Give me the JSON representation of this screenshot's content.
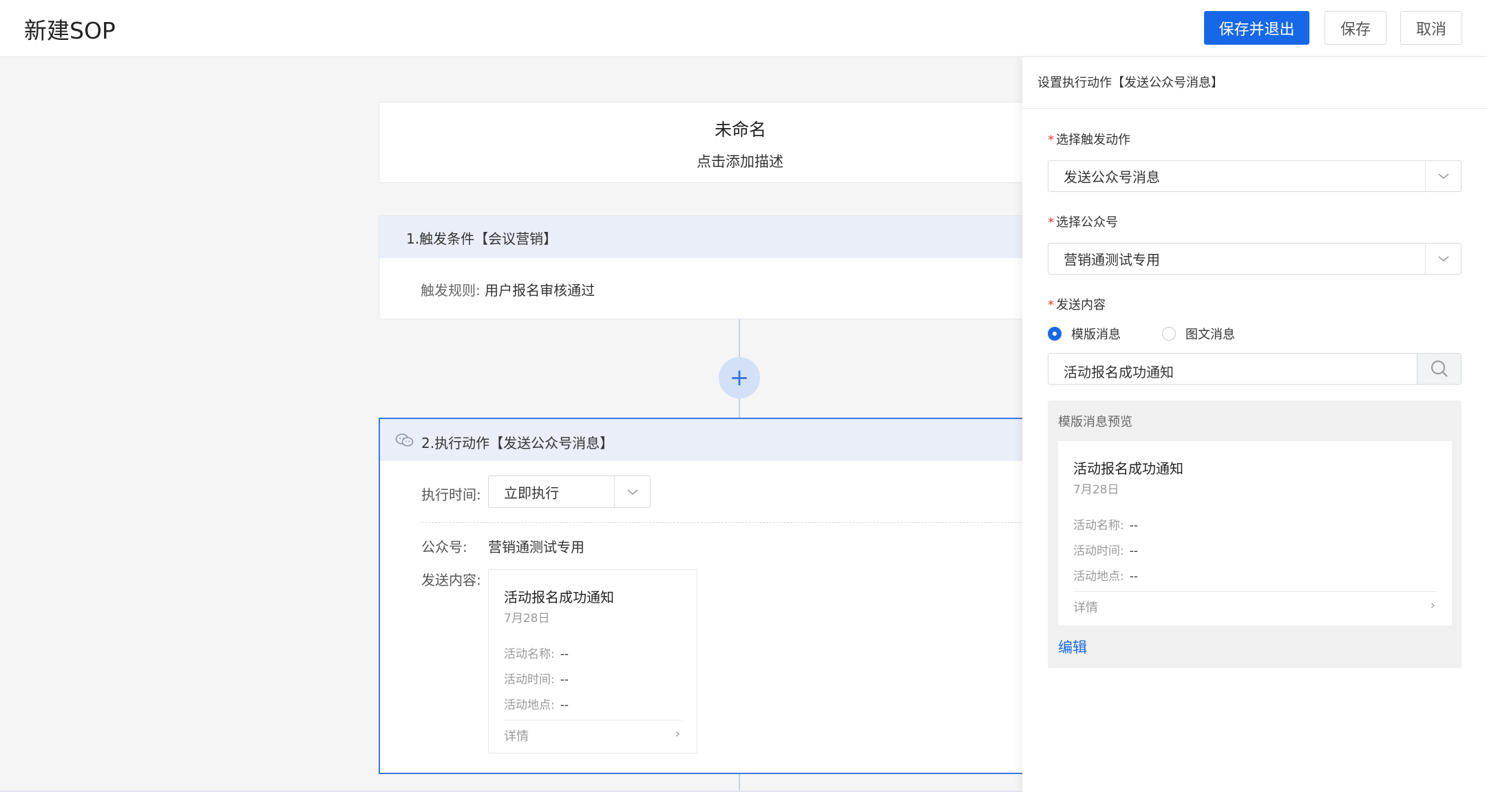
{
  "header": {
    "title": "新建SOP",
    "save_exit": "保存并退出",
    "save": "保存",
    "cancel": "取消"
  },
  "canvas": {
    "sop_name": "未命名",
    "sop_desc": "点击添加描述",
    "trigger": {
      "title": "1.触发条件【会议营销】",
      "rule_label": "触发规则:",
      "rule_value": "用户报名审核通过"
    },
    "add_symbol": "+",
    "action": {
      "title": "2.执行动作【发送公众号消息】",
      "exec_time_label": "执行时间:",
      "exec_time_value": "立即执行",
      "account_label": "公众号:",
      "account_value": "营销通测试专用",
      "content_label": "发送内容:"
    }
  },
  "template": {
    "title": "活动报名成功通知",
    "date": "7月28日",
    "rows": [
      {
        "label": "活动名称:",
        "value": "--"
      },
      {
        "label": "活动时间:",
        "value": "--"
      },
      {
        "label": "活动地点:",
        "value": "--"
      }
    ],
    "detail": "详情",
    "chevron": "›"
  },
  "panel": {
    "title": "设置执行动作【发送公众号消息】",
    "required_mark": "*",
    "trigger_action_label": "选择触发动作",
    "trigger_action_value": "发送公众号消息",
    "account_label": "选择公众号",
    "account_value": "营销通测试专用",
    "content_label": "发送内容",
    "radio_template": "模版消息",
    "radio_rich": "图文消息",
    "search_value": "活动报名成功通知",
    "preview_title": "模版消息预览",
    "edit": "编辑"
  },
  "colors": {
    "primary": "#1668e8",
    "head_bg": "#e9eef8",
    "required": "#e53935"
  }
}
